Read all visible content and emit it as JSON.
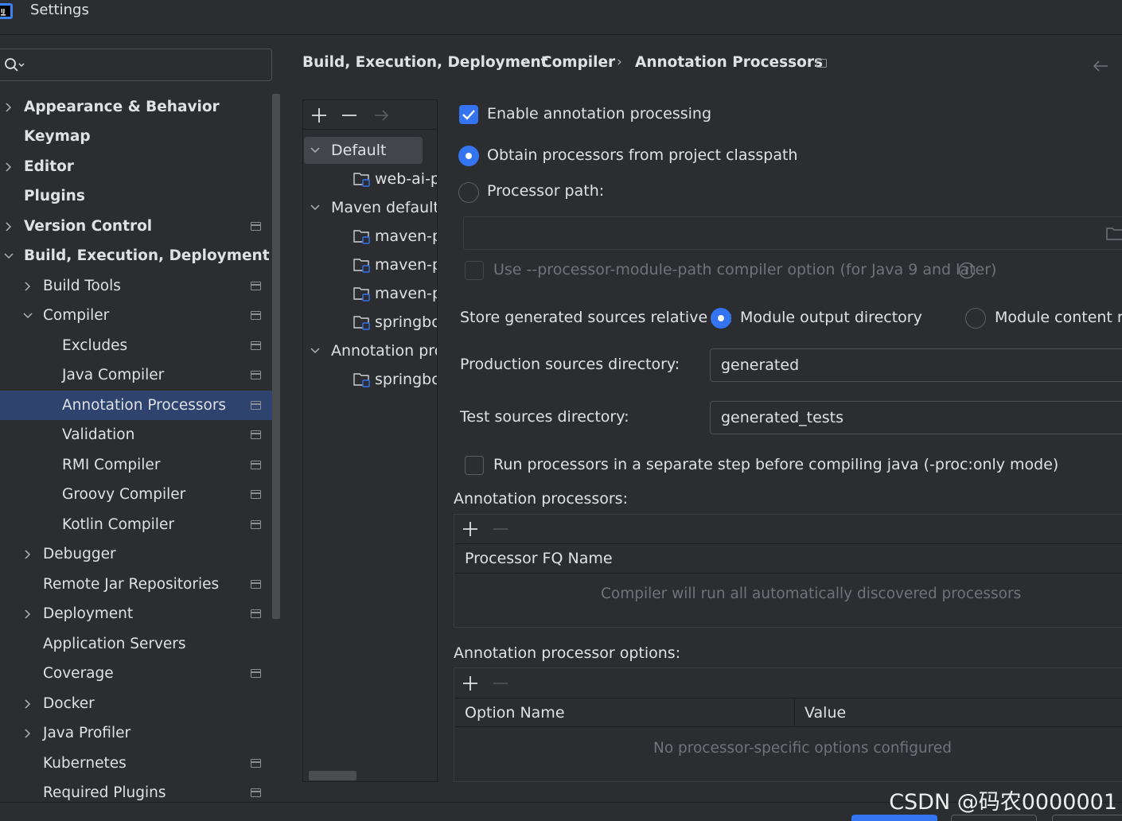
{
  "window": {
    "title": "Settings"
  },
  "search": {
    "placeholder": ""
  },
  "breadcrumb": [
    "Build, Execution, Deployment",
    "Compiler",
    "Annotation Processors"
  ],
  "sidebar": {
    "items": [
      {
        "label": "Appearance & Behavior",
        "bold": true,
        "chevron": "right",
        "project": false
      },
      {
        "label": "Keymap",
        "bold": true,
        "chevron": "",
        "project": false
      },
      {
        "label": "Editor",
        "bold": true,
        "chevron": "right",
        "project": false
      },
      {
        "label": "Plugins",
        "bold": true,
        "chevron": "",
        "project": false
      },
      {
        "label": "Version Control",
        "bold": true,
        "chevron": "right",
        "project": true
      },
      {
        "label": "Build, Execution, Deployment",
        "bold": true,
        "chevron": "down",
        "project": false
      },
      {
        "label": "Build Tools",
        "bold": false,
        "chevron": "right",
        "project": true
      },
      {
        "label": "Compiler",
        "bold": false,
        "chevron": "down",
        "project": true
      },
      {
        "label": "Excludes",
        "bold": false,
        "chevron": "",
        "project": true
      },
      {
        "label": "Java Compiler",
        "bold": false,
        "chevron": "",
        "project": true
      },
      {
        "label": "Annotation Processors",
        "bold": false,
        "chevron": "",
        "project": true,
        "selected": true
      },
      {
        "label": "Validation",
        "bold": false,
        "chevron": "",
        "project": true
      },
      {
        "label": "RMI Compiler",
        "bold": false,
        "chevron": "",
        "project": true
      },
      {
        "label": "Groovy Compiler",
        "bold": false,
        "chevron": "",
        "project": true
      },
      {
        "label": "Kotlin Compiler",
        "bold": false,
        "chevron": "",
        "project": true
      },
      {
        "label": "Debugger",
        "bold": false,
        "chevron": "right",
        "project": false
      },
      {
        "label": "Remote Jar Repositories",
        "bold": false,
        "chevron": "",
        "project": true
      },
      {
        "label": "Deployment",
        "bold": false,
        "chevron": "right",
        "project": true
      },
      {
        "label": "Application Servers",
        "bold": false,
        "chevron": "",
        "project": false
      },
      {
        "label": "Coverage",
        "bold": false,
        "chevron": "",
        "project": true
      },
      {
        "label": "Docker",
        "bold": false,
        "chevron": "right",
        "project": false
      },
      {
        "label": "Java Profiler",
        "bold": false,
        "chevron": "right",
        "project": false
      },
      {
        "label": "Kubernetes",
        "bold": false,
        "chevron": "",
        "project": true
      },
      {
        "label": "Required Plugins",
        "bold": false,
        "chevron": "",
        "project": true
      }
    ]
  },
  "profiles": {
    "items": [
      {
        "label": "Default",
        "type": "group"
      },
      {
        "label": "web-ai-p",
        "type": "module"
      },
      {
        "label": "Maven default a",
        "type": "group"
      },
      {
        "label": "maven-p",
        "type": "module"
      },
      {
        "label": "maven-p",
        "type": "module"
      },
      {
        "label": "maven-p",
        "type": "module"
      },
      {
        "label": "springbo",
        "type": "module"
      },
      {
        "label": "Annotation pro",
        "type": "group"
      },
      {
        "label": "springbo",
        "type": "module"
      }
    ]
  },
  "settings": {
    "enable_processing": "Enable annotation processing",
    "obtain_classpath": "Obtain processors from project classpath",
    "processor_path": "Processor path:",
    "processor_path_value": "",
    "module_path_option": "Use --processor-module-path compiler option (for Java 9 and later)",
    "store_relative": "Store generated sources relative to:",
    "module_output": "Module output directory",
    "module_content": "Module content ro",
    "production_dir_label": "Production sources directory:",
    "production_dir_value": "generated",
    "test_dir_label": "Test sources directory:",
    "test_dir_value": "generated_tests",
    "run_separate": "Run processors in a separate step before compiling java (-proc:only mode)",
    "processors_title": "Annotation processors:",
    "processors_col": "Processor FQ Name",
    "processors_empty": "Compiler will run all automatically discovered processors",
    "options_title": "Annotation processor options:",
    "options_col_name": "Option Name",
    "options_col_value": "Value",
    "options_empty": "No processor-specific options configured"
  },
  "watermark": "CSDN @码农0000001",
  "colors": {
    "accent": "#3574f0",
    "selection": "#2e436e",
    "background": "#2b2d30"
  }
}
